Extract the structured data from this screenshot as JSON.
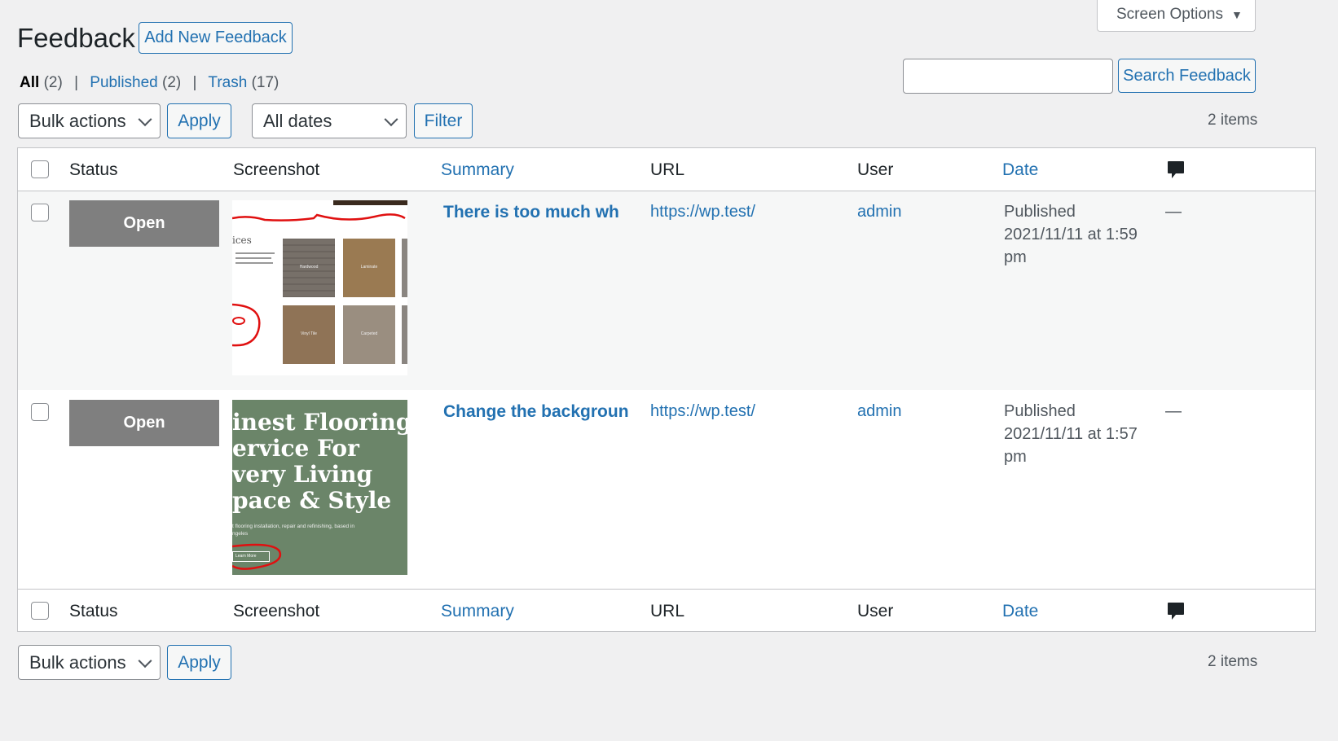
{
  "page": {
    "title": "Feedback",
    "add_new_label": "Add New Feedback",
    "screen_options_label": "Screen Options"
  },
  "filters": {
    "all_label": "All",
    "all_count": "(2)",
    "published_label": "Published",
    "published_count": "(2)",
    "trash_label": "Trash",
    "trash_count": "(17)"
  },
  "search": {
    "placeholder": "",
    "value": "",
    "button_label": "Search Feedback"
  },
  "tablenav_top": {
    "bulk_actions": "Bulk actions",
    "apply_label": "Apply",
    "dates_value": "All dates",
    "filter_label": "Filter",
    "items_count": "2 items"
  },
  "table": {
    "columns": {
      "status": "Status",
      "screenshot": "Screenshot",
      "summary": "Summary",
      "url": "URL",
      "user": "User",
      "date": "Date",
      "comments_icon": "comment-bubble-icon"
    },
    "rows": [
      {
        "status": "Open",
        "summary": "There is too much wh",
        "url": "https://wp.test/",
        "user": "admin",
        "date_status": "Published",
        "date_line1": "2021/11/11 at 1:59",
        "date_line2": "pm",
        "comments": "—",
        "screenshot": {
          "heading": "ices",
          "tiles": [
            "Hardwood",
            "Laminate",
            "Vinyl Tile",
            "Carpeted"
          ]
        }
      },
      {
        "status": "Open",
        "summary": "Change the backgroun",
        "url": "https://wp.test/",
        "user": "admin",
        "date_status": "Published",
        "date_line1": "2021/11/11 at 1:57",
        "date_line2": "pm",
        "comments": "—",
        "screenshot": {
          "line1": "inest Flooring",
          "line2": "ervice For",
          "line3": "very Living",
          "line4": "pace & Style",
          "subtext1": "t flooring installation, repair and refinishing, based in",
          "subtext2": "ngeles",
          "button": "Learn More",
          "bg_color": "#6b8569"
        }
      }
    ]
  },
  "tablenav_bottom": {
    "bulk_actions": "Bulk actions",
    "apply_label": "Apply",
    "items_count": "2 items"
  },
  "colors": {
    "accent": "#2271b1",
    "status_bg": "#7f7f7f",
    "background": "#f0f0f1"
  }
}
